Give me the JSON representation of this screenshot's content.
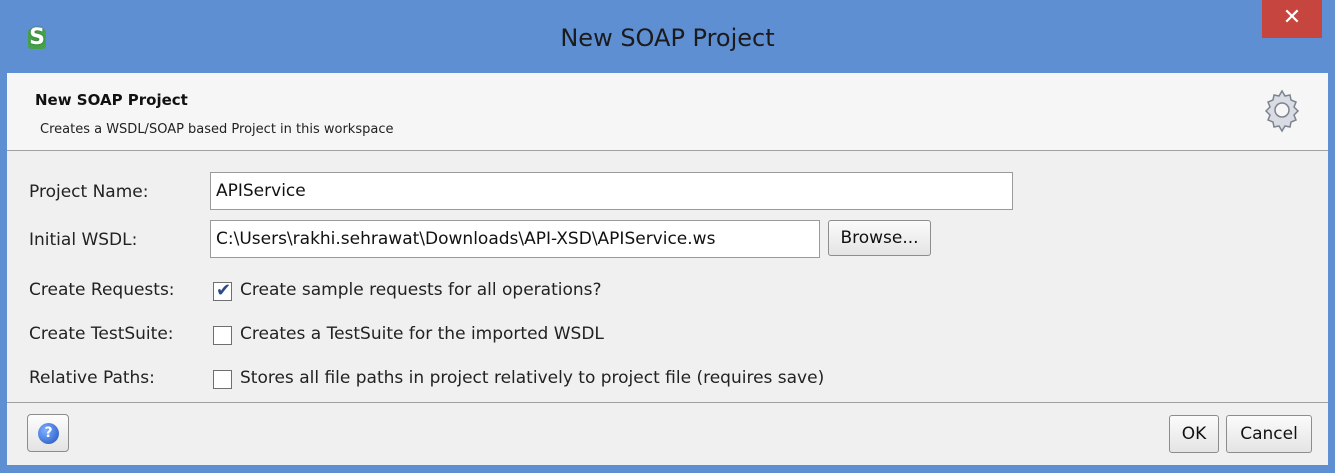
{
  "window": {
    "title": "New SOAP Project",
    "app_icon_letter": "S",
    "close_label": "✕"
  },
  "banner": {
    "title": "New SOAP Project",
    "subtitle": "Creates a WSDL/SOAP based Project in this workspace",
    "icon": "gear-icon"
  },
  "form": {
    "project_name": {
      "label": "Project Name:",
      "value": "APIService"
    },
    "initial_wsdl": {
      "label": "Initial WSDL:",
      "value": "C:\\Users\\rakhi.sehrawat\\Downloads\\API-XSD\\APIService.ws",
      "browse_label": "Browse..."
    },
    "create_requests": {
      "label": "Create Requests:",
      "text": "Create sample requests for all operations?",
      "checked": true
    },
    "create_testsuite": {
      "label": "Create TestSuite:",
      "text": "Creates a TestSuite for the imported WSDL",
      "checked": false
    },
    "relative_paths": {
      "label": "Relative Paths:",
      "text": "Stores all file paths in project relatively to project file (requires save)",
      "checked": false
    }
  },
  "footer": {
    "help_icon": "help-icon",
    "help_glyph": "?",
    "ok_label": "OK",
    "cancel_label": "Cancel"
  },
  "colors": {
    "titlebar": "#5f8fd3",
    "close_button": "#c7453f",
    "dialog_background": "#f0f0f0"
  }
}
